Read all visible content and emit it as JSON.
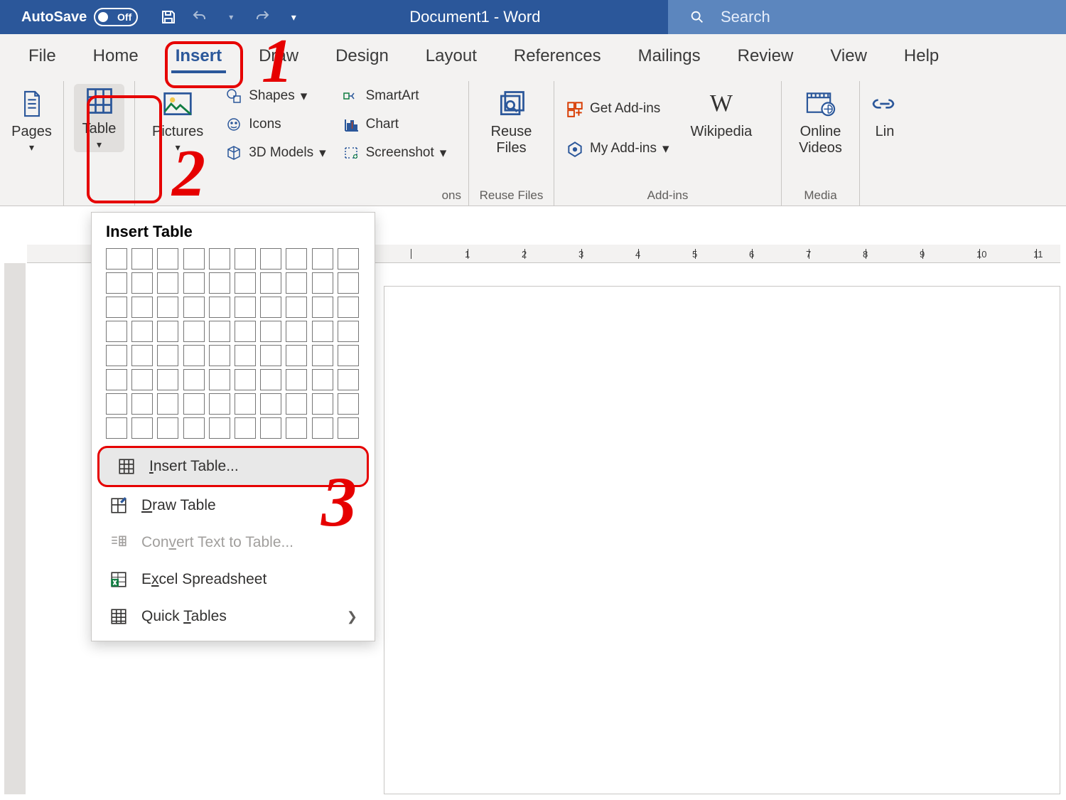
{
  "titlebar": {
    "autosave": "AutoSave",
    "toggle_off": "Off",
    "document": "Document1  -  Word",
    "search_placeholder": "Search"
  },
  "tabs": {
    "file": "File",
    "home": "Home",
    "insert": "Insert",
    "draw": "Draw",
    "design": "Design",
    "layout": "Layout",
    "references": "References",
    "mailings": "Mailings",
    "review": "Review",
    "view": "View",
    "help": "Help"
  },
  "ribbon": {
    "pages": "Pages",
    "table": "Table",
    "pictures": "Pictures",
    "shapes": "Shapes",
    "icons": "Icons",
    "models3d": "3D Models",
    "smartart": "SmartArt",
    "chart": "Chart",
    "screenshot": "Screenshot",
    "reuse_files": "Reuse\nFiles",
    "reuse_files_group": "Reuse Files",
    "get_addins": "Get Add-ins",
    "my_addins": "My Add-ins",
    "addins_group": "Add-ins",
    "wikipedia": "Wikipedia",
    "online_videos": "Online\nVideos",
    "media_group": "Media",
    "link": "Lin",
    "illustrations_group_hint": "ons"
  },
  "dropdown": {
    "title": "Insert Table",
    "insert_table": "Insert Table...",
    "draw_table": "Draw Table",
    "convert": "Convert Text to Table...",
    "excel": "Excel Spreadsheet",
    "quick": "Quick Tables"
  },
  "ruler_numbers": [
    "1",
    "2",
    "3",
    "4",
    "5",
    "6",
    "7",
    "8",
    "9",
    "10",
    "11"
  ],
  "annotations": {
    "n1": "1",
    "n2": "2",
    "n3": "3"
  }
}
